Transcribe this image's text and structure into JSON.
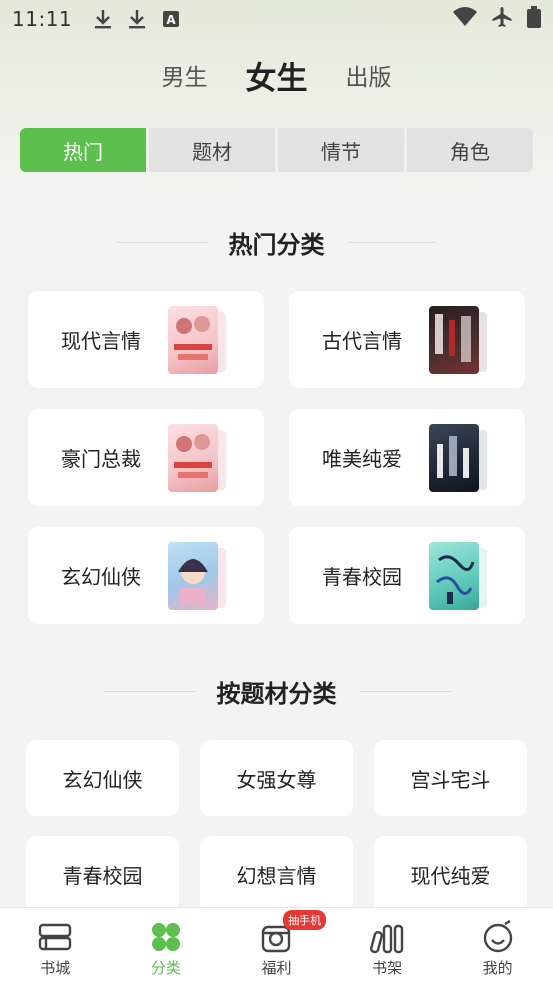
{
  "status_bar": {
    "time": "11:11",
    "left_icons": [
      "download-icon",
      "download-icon",
      "font-a-icon"
    ],
    "right_icons": [
      "wifi-icon",
      "airplane-icon",
      "battery-icon"
    ]
  },
  "gender_tabs": {
    "items": [
      "男生",
      "女生",
      "出版"
    ],
    "selected": "女生"
  },
  "sub_tabs": {
    "items": [
      "热门",
      "题材",
      "情节",
      "角色"
    ],
    "selected": "热门"
  },
  "hot_section": {
    "title": "热门分类",
    "cards": [
      {
        "label": "现代言情",
        "cover_color": "#f4c4c8",
        "cover_accent": "#d9443f"
      },
      {
        "label": "古代言情",
        "cover_color": "#3a2a2a",
        "cover_accent": "#b32a2a"
      },
      {
        "label": "豪门总裁",
        "cover_color": "#f4c4c8",
        "cover_accent": "#d9443f"
      },
      {
        "label": "唯美纯爱",
        "cover_color": "#1f2633",
        "cover_accent": "#e8e8e8"
      },
      {
        "label": "玄幻仙侠",
        "cover_color": "#9fc8e8",
        "cover_accent": "#e9b2c8"
      },
      {
        "label": "青春校园",
        "cover_color": "#5ec9b8",
        "cover_accent": "#2a4fa0"
      }
    ]
  },
  "topic_section": {
    "title": "按题材分类",
    "cards": [
      "玄幻仙侠",
      "女强女尊",
      "宫斗宅斗",
      "青春校园",
      "幻想言情",
      "现代纯爱"
    ]
  },
  "bottom_nav": {
    "items": [
      {
        "label": "书城",
        "icon": "bookstore-icon"
      },
      {
        "label": "分类",
        "icon": "category-icon"
      },
      {
        "label": "福利",
        "icon": "gift-icon",
        "badge": "抽手机"
      },
      {
        "label": "书架",
        "icon": "bookshelf-icon"
      },
      {
        "label": "我的",
        "icon": "profile-icon"
      }
    ],
    "selected": "分类"
  },
  "colors": {
    "accent": "#5cbf4e",
    "badge": "#e53935",
    "background": "#f3f3f3"
  }
}
